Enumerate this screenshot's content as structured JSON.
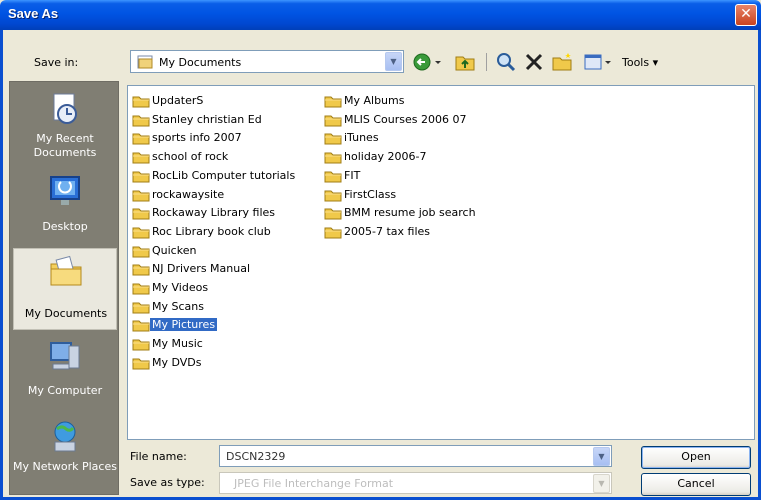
{
  "window": {
    "title": "Save As",
    "close_glyph": "✕"
  },
  "toolbar": {
    "save_in_label": "Save in:",
    "save_in_value": "My Documents",
    "tools_label": "Tools",
    "tools_arrow": "▾",
    "combo_arrow": "▼"
  },
  "places": [
    {
      "label": "My Recent Documents",
      "icon": "recent-documents-icon"
    },
    {
      "label": "Desktop",
      "icon": "desktop-icon"
    },
    {
      "label": "My Documents",
      "icon": "my-documents-icon",
      "selected": true
    },
    {
      "label": "My Computer",
      "icon": "my-computer-icon"
    },
    {
      "label": "My Network Places",
      "icon": "network-places-icon"
    }
  ],
  "files": {
    "column1": [
      "UpdaterS",
      "Stanley christian Ed",
      "sports info 2007",
      "school of rock",
      "RocLib Computer tutorials",
      "rockawaysite",
      "Rockaway Library files",
      "Roc Library book club",
      "Quicken",
      "NJ Drivers Manual",
      "My Videos",
      "My Scans",
      "My Pictures",
      "My Music",
      "My DVDs"
    ],
    "column2": [
      "My Albums",
      "MLIS Courses 2006 07",
      "iTunes",
      "holiday 2006-7",
      "FIT",
      "FirstClass",
      "BMM resume job search",
      "2005-7 tax files"
    ],
    "selected": "My Pictures"
  },
  "bottom": {
    "file_name_label": "File name:",
    "file_name_value": "DSCN2329",
    "save_as_type_label": "Save as type:",
    "save_as_type_value": "JPEG File Interchange Format",
    "open_label": "Open",
    "cancel_label": "Cancel"
  },
  "colors": {
    "titlebar": "#0054e3",
    "selection": "#316ac5",
    "places_bg": "#807e73",
    "dialog_bg": "#ece9d8"
  }
}
